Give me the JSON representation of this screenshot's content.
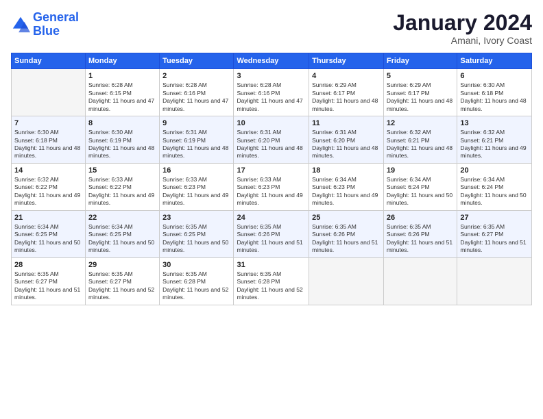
{
  "header": {
    "logo_line1": "General",
    "logo_line2": "Blue",
    "month_title": "January 2024",
    "subtitle": "Amani, Ivory Coast"
  },
  "days_of_week": [
    "Sunday",
    "Monday",
    "Tuesday",
    "Wednesday",
    "Thursday",
    "Friday",
    "Saturday"
  ],
  "weeks": [
    [
      {
        "day": "",
        "sunrise": "",
        "sunset": "",
        "daylight": "",
        "empty": true
      },
      {
        "day": "1",
        "sunrise": "6:28 AM",
        "sunset": "6:15 PM",
        "daylight": "11 hours and 47 minutes."
      },
      {
        "day": "2",
        "sunrise": "6:28 AM",
        "sunset": "6:16 PM",
        "daylight": "11 hours and 47 minutes."
      },
      {
        "day": "3",
        "sunrise": "6:28 AM",
        "sunset": "6:16 PM",
        "daylight": "11 hours and 47 minutes."
      },
      {
        "day": "4",
        "sunrise": "6:29 AM",
        "sunset": "6:17 PM",
        "daylight": "11 hours and 48 minutes."
      },
      {
        "day": "5",
        "sunrise": "6:29 AM",
        "sunset": "6:17 PM",
        "daylight": "11 hours and 48 minutes."
      },
      {
        "day": "6",
        "sunrise": "6:30 AM",
        "sunset": "6:18 PM",
        "daylight": "11 hours and 48 minutes."
      }
    ],
    [
      {
        "day": "7",
        "sunrise": "6:30 AM",
        "sunset": "6:18 PM",
        "daylight": "11 hours and 48 minutes."
      },
      {
        "day": "8",
        "sunrise": "6:30 AM",
        "sunset": "6:19 PM",
        "daylight": "11 hours and 48 minutes."
      },
      {
        "day": "9",
        "sunrise": "6:31 AM",
        "sunset": "6:19 PM",
        "daylight": "11 hours and 48 minutes."
      },
      {
        "day": "10",
        "sunrise": "6:31 AM",
        "sunset": "6:20 PM",
        "daylight": "11 hours and 48 minutes."
      },
      {
        "day": "11",
        "sunrise": "6:31 AM",
        "sunset": "6:20 PM",
        "daylight": "11 hours and 48 minutes."
      },
      {
        "day": "12",
        "sunrise": "6:32 AM",
        "sunset": "6:21 PM",
        "daylight": "11 hours and 48 minutes."
      },
      {
        "day": "13",
        "sunrise": "6:32 AM",
        "sunset": "6:21 PM",
        "daylight": "11 hours and 49 minutes."
      }
    ],
    [
      {
        "day": "14",
        "sunrise": "6:32 AM",
        "sunset": "6:22 PM",
        "daylight": "11 hours and 49 minutes."
      },
      {
        "day": "15",
        "sunrise": "6:33 AM",
        "sunset": "6:22 PM",
        "daylight": "11 hours and 49 minutes."
      },
      {
        "day": "16",
        "sunrise": "6:33 AM",
        "sunset": "6:23 PM",
        "daylight": "11 hours and 49 minutes."
      },
      {
        "day": "17",
        "sunrise": "6:33 AM",
        "sunset": "6:23 PM",
        "daylight": "11 hours and 49 minutes."
      },
      {
        "day": "18",
        "sunrise": "6:34 AM",
        "sunset": "6:23 PM",
        "daylight": "11 hours and 49 minutes."
      },
      {
        "day": "19",
        "sunrise": "6:34 AM",
        "sunset": "6:24 PM",
        "daylight": "11 hours and 50 minutes."
      },
      {
        "day": "20",
        "sunrise": "6:34 AM",
        "sunset": "6:24 PM",
        "daylight": "11 hours and 50 minutes."
      }
    ],
    [
      {
        "day": "21",
        "sunrise": "6:34 AM",
        "sunset": "6:25 PM",
        "daylight": "11 hours and 50 minutes."
      },
      {
        "day": "22",
        "sunrise": "6:34 AM",
        "sunset": "6:25 PM",
        "daylight": "11 hours and 50 minutes."
      },
      {
        "day": "23",
        "sunrise": "6:35 AM",
        "sunset": "6:25 PM",
        "daylight": "11 hours and 50 minutes."
      },
      {
        "day": "24",
        "sunrise": "6:35 AM",
        "sunset": "6:26 PM",
        "daylight": "11 hours and 51 minutes."
      },
      {
        "day": "25",
        "sunrise": "6:35 AM",
        "sunset": "6:26 PM",
        "daylight": "11 hours and 51 minutes."
      },
      {
        "day": "26",
        "sunrise": "6:35 AM",
        "sunset": "6:26 PM",
        "daylight": "11 hours and 51 minutes."
      },
      {
        "day": "27",
        "sunrise": "6:35 AM",
        "sunset": "6:27 PM",
        "daylight": "11 hours and 51 minutes."
      }
    ],
    [
      {
        "day": "28",
        "sunrise": "6:35 AM",
        "sunset": "6:27 PM",
        "daylight": "11 hours and 51 minutes."
      },
      {
        "day": "29",
        "sunrise": "6:35 AM",
        "sunset": "6:27 PM",
        "daylight": "11 hours and 52 minutes."
      },
      {
        "day": "30",
        "sunrise": "6:35 AM",
        "sunset": "6:28 PM",
        "daylight": "11 hours and 52 minutes."
      },
      {
        "day": "31",
        "sunrise": "6:35 AM",
        "sunset": "6:28 PM",
        "daylight": "11 hours and 52 minutes."
      },
      {
        "day": "",
        "sunrise": "",
        "sunset": "",
        "daylight": "",
        "empty": true
      },
      {
        "day": "",
        "sunrise": "",
        "sunset": "",
        "daylight": "",
        "empty": true
      },
      {
        "day": "",
        "sunrise": "",
        "sunset": "",
        "daylight": "",
        "empty": true
      }
    ]
  ],
  "labels": {
    "sunrise": "Sunrise:",
    "sunset": "Sunset:",
    "daylight": "Daylight:"
  }
}
